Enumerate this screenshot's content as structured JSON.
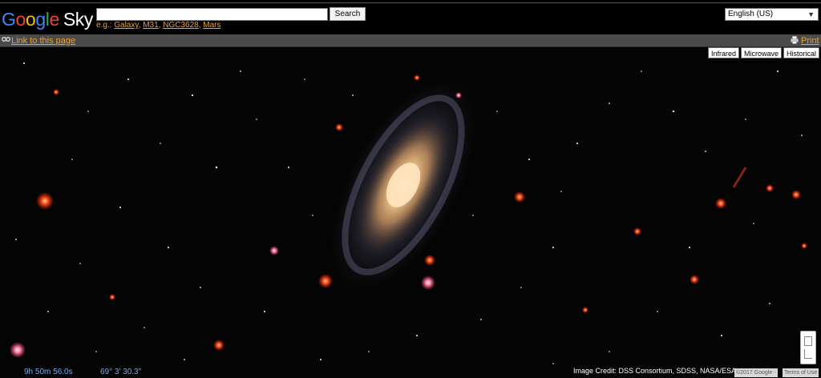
{
  "logo": {
    "letters": [
      "G",
      "o",
      "o",
      "g",
      "l",
      "e"
    ],
    "product": "Sky"
  },
  "search": {
    "value": "",
    "placeholder": "",
    "button_label": "Search",
    "examples_prefix": "e.g.:",
    "examples": [
      "Galaxy",
      "M31",
      "NGC3628",
      "Mars"
    ]
  },
  "language": {
    "selected": "English (US)"
  },
  "toolbar": {
    "link_label": "Link to this page",
    "print_label": "Print"
  },
  "layers": [
    "Infrared",
    "Microwave",
    "Historical"
  ],
  "coordinates": {
    "ra": "9h 50m 56.0s",
    "dec": "69° 3' 30.3\""
  },
  "footer": {
    "credits": "Image Credit: DSS Consortium, SDSS, NASA/ESA",
    "copyright": "©2017 Google -",
    "terms": "Terms of Use"
  },
  "icons": {
    "link": "link-icon",
    "print": "printer-icon",
    "caret": "chevron-down-icon"
  },
  "colors": {
    "link": "#f0a030",
    "toolbar": "#4a4a4a",
    "coordinates": "#7aa7e8",
    "sky": "#050404"
  }
}
